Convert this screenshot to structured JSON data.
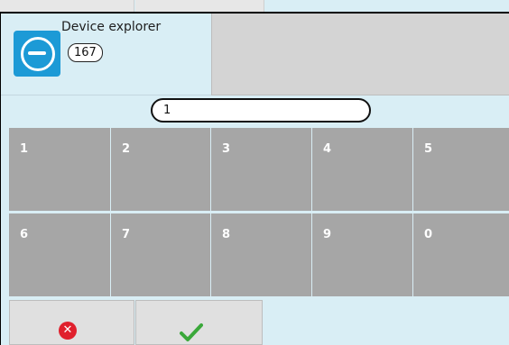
{
  "header": {
    "title": "Device explorer",
    "count": "167",
    "app_icon": "device-explorer-app-icon"
  },
  "input": {
    "value": "1"
  },
  "keypad": {
    "row1": [
      "1",
      "2",
      "3",
      "4",
      "5"
    ],
    "row2": [
      "6",
      "7",
      "8",
      "9",
      "0"
    ]
  },
  "actions": {
    "cancel_icon": "cancel-circle-x-icon",
    "confirm_icon": "green-checkmark-icon"
  },
  "colors": {
    "background": "#d9eef5",
    "key": "#a6a6a6",
    "app_icon": "#1c9ad6",
    "cancel": "#e0202d",
    "confirm": "#3aa83a"
  }
}
